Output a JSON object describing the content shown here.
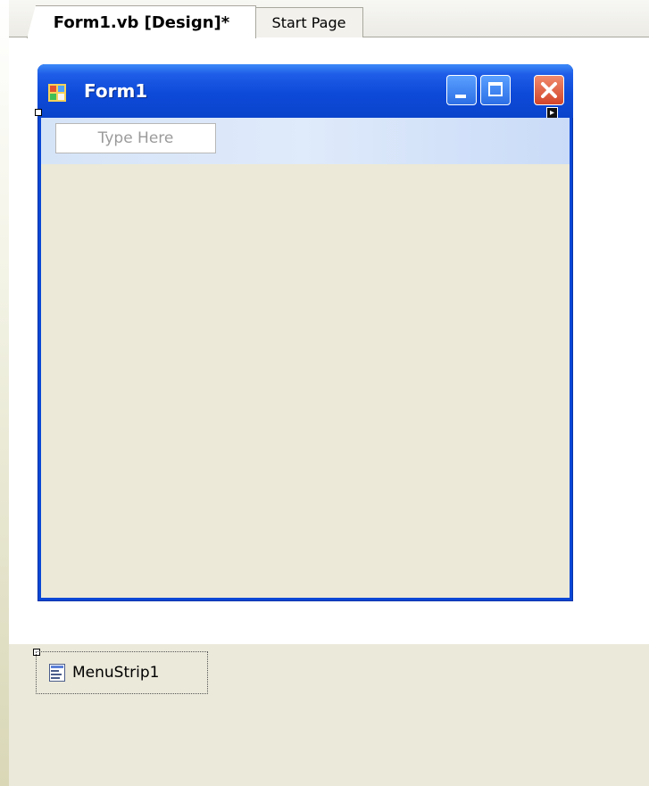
{
  "tabs": [
    {
      "label": "Form1.vb [Design]*",
      "active": true
    },
    {
      "label": "Start Page",
      "active": false
    }
  ],
  "form": {
    "title": "Form1",
    "menu_strip": {
      "placeholder": "Type Here"
    }
  },
  "component_tray": {
    "items": [
      {
        "label": "MenuStrip1",
        "icon": "menustrip-icon"
      }
    ]
  },
  "colors": {
    "title_bar": "#0a47d6",
    "menu_strip": "#d6e4f8",
    "client_area": "#ece9d8",
    "close_button": "#d2452a",
    "tray": "#ebe9da"
  }
}
